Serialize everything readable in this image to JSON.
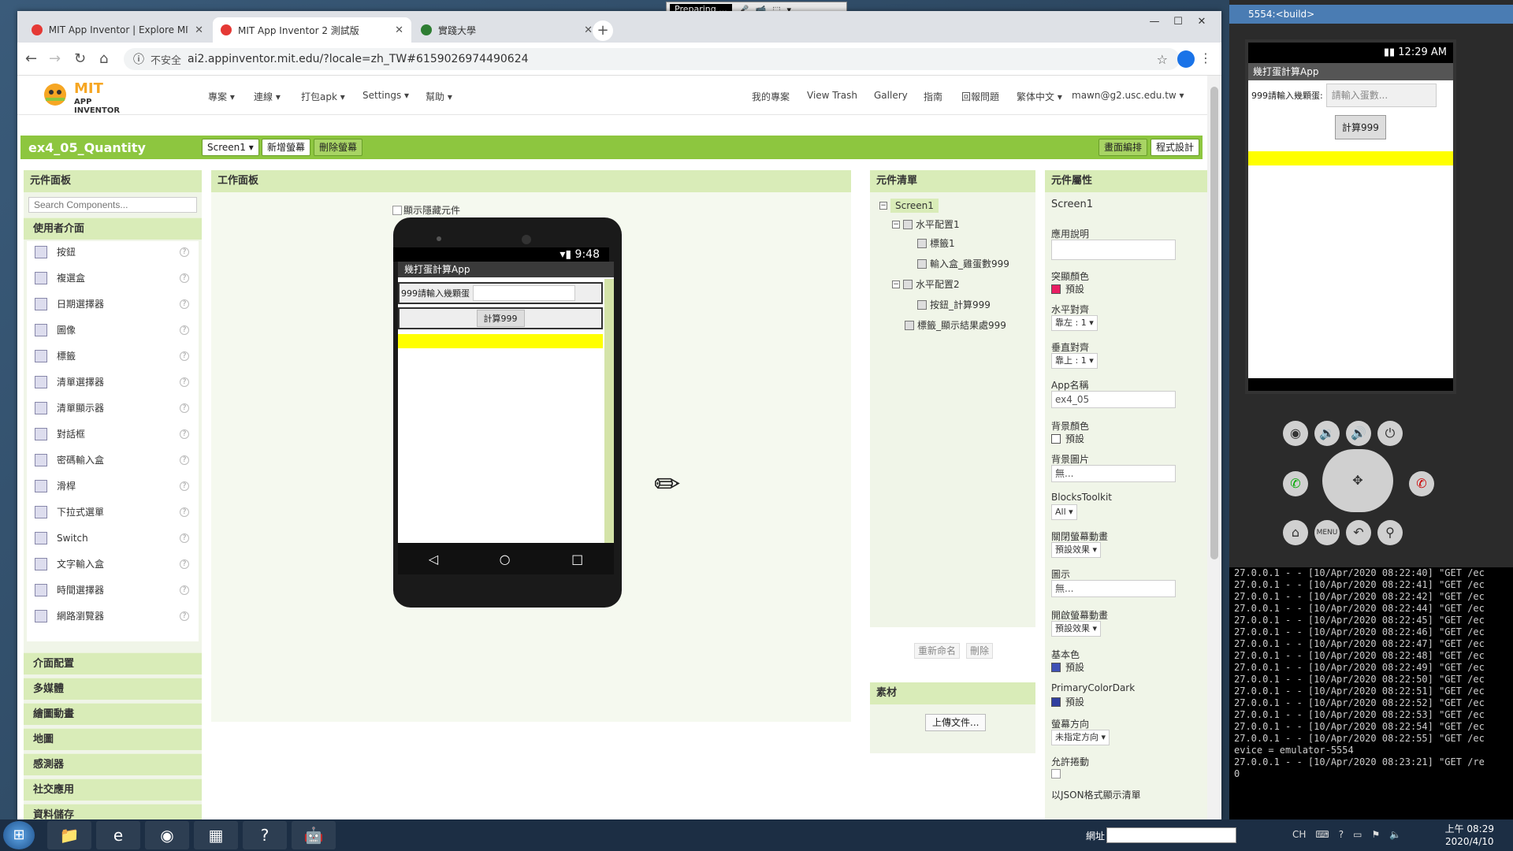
{
  "browser": {
    "tabs": [
      {
        "title": "MIT App Inventor | Explore MIT",
        "fav": "#e53935"
      },
      {
        "title": "MIT App Inventor 2 測試版",
        "fav": "#e53935"
      },
      {
        "title": "實踐大學",
        "fav": "#2e7d32"
      }
    ],
    "url_insecure": "不安全",
    "url": "ai2.appinventor.mit.edu/?locale=zh_TW#6159026974490624"
  },
  "recorder": {
    "status": "Preparing ..."
  },
  "ai": {
    "logo_text": "MIT",
    "logo_sub": "APP INVENTOR",
    "menus": [
      "專案 ▾",
      "連線 ▾",
      "打包apk ▾",
      "Settings ▾",
      "幫助 ▾"
    ],
    "right_menus": [
      "我的專案",
      "View Trash",
      "Gallery",
      "指南",
      "回報問題",
      "繁体中文 ▾",
      "mawn@g2.usc.edu.tw ▾"
    ],
    "project_name": "ex4_05_Quantity",
    "screen_select": "Screen1 ▾",
    "add_screen": "新增螢幕",
    "remove_screen": "刪除螢幕",
    "designer": "畫面編排",
    "blocks": "程式設計"
  },
  "palette": {
    "title": "元件面板",
    "search_placeholder": "Search Components...",
    "section": "使用者介面",
    "items": [
      "按鈕",
      "複選盒",
      "日期選擇器",
      "圖像",
      "標籤",
      "清單選擇器",
      "清單顯示器",
      "對話框",
      "密碼輸入盒",
      "滑桿",
      "下拉式選單",
      "Switch",
      "文字輸入盒",
      "時間選擇器",
      "網路瀏覽器"
    ],
    "sections": [
      "介面配置",
      "多媒體",
      "繪圖動畫",
      "地圖",
      "感測器",
      "社交應用",
      "資料儲存"
    ]
  },
  "viewer": {
    "title": "工作面板",
    "hidden_label": "顯示隱藏元件",
    "time": "9:48",
    "app_title": "幾打蛋計算App",
    "label1": "999請輸入幾顆蛋",
    "button": "計算999"
  },
  "tree": {
    "title": "元件清單",
    "nodes": [
      "Screen1",
      "水平配置1",
      "標籤1",
      "輸入盒_雞蛋數999",
      "水平配置2",
      "按鈕_計算999",
      "標籤_顯示結果處999"
    ],
    "rename": "重新命名",
    "delete": "刪除"
  },
  "media": {
    "title": "素材",
    "upload": "上傳文件..."
  },
  "props": {
    "title": "元件屬性",
    "component": "Screen1",
    "fields": {
      "about_label": "應用說明",
      "accent_label": "突顯顏色",
      "accent_value": "預設",
      "halign_label": "水平對齊",
      "halign_value": "靠左 : 1 ▾",
      "valign_label": "垂直對齊",
      "valign_value": "靠上 : 1 ▾",
      "appname_label": "App名稱",
      "appname_value": "ex4_05",
      "bgcolor_label": "背景顏色",
      "bgcolor_value": "預設",
      "bgimg_label": "背景圖片",
      "bgimg_value": "無...",
      "blockstoolkit_label": "BlocksToolkit",
      "blockstoolkit_value": "All ▾",
      "closeanim_label": "關閉螢幕動畫",
      "closeanim_value": "預設效果 ▾",
      "icon_label": "圖示",
      "icon_value": "無...",
      "openanim_label": "開啟螢幕動畫",
      "openanim_value": "預設效果 ▾",
      "primary_label": "基本色",
      "primary_value": "預設",
      "primarydark_label": "PrimaryColorDark",
      "primarydark_value": "預設",
      "orient_label": "螢幕方向",
      "orient_value": "未指定方向 ▾",
      "scroll_label": "允許捲動",
      "json_label": "以JSON格式顯示清單"
    },
    "colors": {
      "accent": "#e91e63",
      "primary": "#3f51b5",
      "primarydark": "#303f9f",
      "bg": "#ffffff"
    }
  },
  "emulator": {
    "title": "5554:<build>",
    "time": "12:29 AM",
    "app_title": "幾打蛋計算App",
    "label": "999請輸入幾顆蛋:",
    "input_placeholder": "請輸入蛋數...",
    "button": "計算999",
    "menu": "MENU"
  },
  "console": {
    "lines": [
      "27.0.0.1 - - [10/Apr/2020 08:22:40] \"GET /ec",
      "27.0.0.1 - - [10/Apr/2020 08:22:41] \"GET /ec",
      "27.0.0.1 - - [10/Apr/2020 08:22:42] \"GET /ec",
      "27.0.0.1 - - [10/Apr/2020 08:22:44] \"GET /ec",
      "27.0.0.1 - - [10/Apr/2020 08:22:45] \"GET /ec",
      "27.0.0.1 - - [10/Apr/2020 08:22:46] \"GET /ec",
      "27.0.0.1 - - [10/Apr/2020 08:22:47] \"GET /ec",
      "27.0.0.1 - - [10/Apr/2020 08:22:48] \"GET /ec",
      "27.0.0.1 - - [10/Apr/2020 08:22:49] \"GET /ec",
      "27.0.0.1 - - [10/Apr/2020 08:22:50] \"GET /ec",
      "27.0.0.1 - - [10/Apr/2020 08:22:51] \"GET /ec",
      "27.0.0.1 - - [10/Apr/2020 08:22:52] \"GET /ec",
      "27.0.0.1 - - [10/Apr/2020 08:22:53] \"GET /ec",
      "27.0.0.1 - - [10/Apr/2020 08:22:54] \"GET /ec",
      "27.0.0.1 - - [10/Apr/2020 08:22:55] \"GET /ec",
      "evice = emulator-5554",
      "27.0.0.1 - - [10/Apr/2020 08:23:21] \"GET /re",
      "0"
    ]
  },
  "taskbar": {
    "net_label": "網址",
    "lang": "CH",
    "time": "上午 08:29",
    "date": "2020/4/10"
  }
}
